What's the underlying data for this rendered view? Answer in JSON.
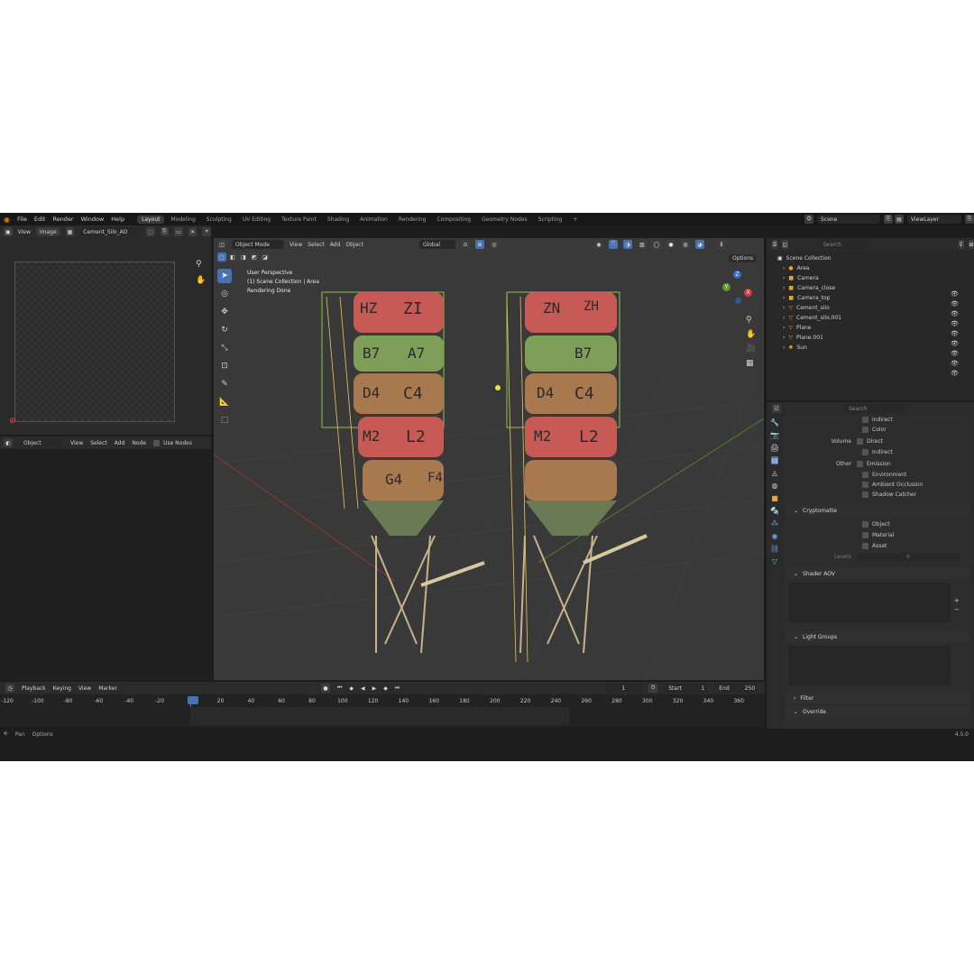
{
  "menu": {
    "items": [
      "File",
      "Edit",
      "Render",
      "Window",
      "Help"
    ],
    "workspaces": [
      "Layout",
      "Modeling",
      "Sculpting",
      "UV Editing",
      "Texture Paint",
      "Shading",
      "Animation",
      "Rendering",
      "Compositing",
      "Geometry Nodes",
      "Scripting"
    ],
    "active_workspace": "Layout",
    "add_tab": "+",
    "scene": "Scene",
    "view_layer": "ViewLayer"
  },
  "image_editor": {
    "view": "View",
    "image": "Image",
    "image_name": "Cement_Silo_AO"
  },
  "node_editor": {
    "object": "Object",
    "view": "View",
    "select": "Select",
    "add": "Add",
    "node": "Node",
    "use_nodes": "Use Nodes"
  },
  "viewport": {
    "mode": "Object Mode",
    "menus": [
      "View",
      "Select",
      "Add",
      "Object"
    ],
    "orientation": "Global",
    "options": "Options",
    "info_line1": "User Perspective",
    "info_line2": "(1) Scene Collection | Area",
    "info_line3": "Rendering Done",
    "gizmo": {
      "z": "Z",
      "y": "Y",
      "x": "X"
    },
    "silo_labels_left": [
      "ZI",
      "HZ",
      "A7",
      "B7",
      "C4",
      "D4",
      "L2",
      "M2",
      "G4",
      "F4"
    ],
    "silo_labels_right": [
      "ZN",
      "ZH",
      "B7",
      "C4",
      "D4",
      "L2",
      "M2"
    ]
  },
  "outliner": {
    "search_placeholder": "Search",
    "root": "Scene Collection",
    "items": [
      {
        "name": "Area",
        "color": "#e8a23a"
      },
      {
        "name": "Camera",
        "color": "#e8a23a"
      },
      {
        "name": "Camera_close",
        "color": "#e8a23a"
      },
      {
        "name": "Camera_top",
        "color": "#e8a23a"
      },
      {
        "name": "Cement_silo",
        "color": "#e8a23a"
      },
      {
        "name": "Cement_silo.001",
        "color": "#e8a23a"
      },
      {
        "name": "Plane",
        "color": "#e8a23a"
      },
      {
        "name": "Plane.001",
        "color": "#e8a23a"
      },
      {
        "name": "Sun",
        "color": "#e8a23a"
      }
    ]
  },
  "properties": {
    "search_placeholder": "Search",
    "rows": [
      {
        "group": "",
        "label": "Indirect"
      },
      {
        "group": "",
        "label": "Color"
      },
      {
        "group": "Volume",
        "label": "Direct"
      },
      {
        "group": "",
        "label": "Indirect"
      },
      {
        "group": "Other",
        "label": "Emission"
      },
      {
        "group": "",
        "label": "Environment"
      },
      {
        "group": "",
        "label": "Ambient Occlusion"
      },
      {
        "group": "",
        "label": "Shadow Catcher"
      }
    ],
    "cryptomatte": {
      "title": "Cryptomatte",
      "items": [
        "Object",
        "Material",
        "Asset"
      ],
      "levels_label": "Levels",
      "levels_value": "6"
    },
    "shader_aov": "Shader AOV",
    "light_groups": "Light Groups",
    "filter": "Filter",
    "override": "Override"
  },
  "timeline": {
    "playback": "Playback",
    "keying": "Keying",
    "view": "View",
    "marker": "Marker",
    "current_frame": "1",
    "start_label": "Start",
    "start": "1",
    "end_label": "End",
    "end": "250",
    "ticks": [
      "-120",
      "-100",
      "-80",
      "-60",
      "-40",
      "-20",
      "1",
      "20",
      "40",
      "60",
      "80",
      "100",
      "120",
      "140",
      "160",
      "180",
      "200",
      "220",
      "240",
      "260",
      "280",
      "300",
      "320",
      "340",
      "360"
    ]
  },
  "status": {
    "pan": "Pan",
    "options": "Options",
    "version": "4.5.0"
  }
}
